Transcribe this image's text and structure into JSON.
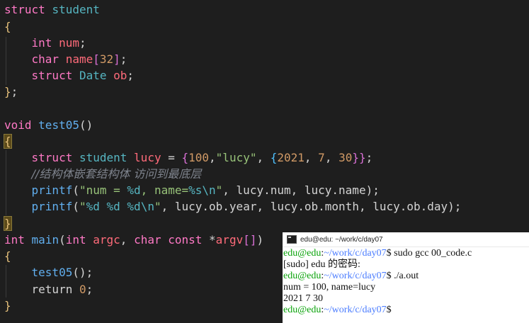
{
  "code": {
    "l1": {
      "k": "struct",
      "n": "student"
    },
    "l2": {
      "b": "{"
    },
    "l3": {
      "t": "int",
      "v": "num",
      "p": ";"
    },
    "l4": {
      "t": "char",
      "v": "name",
      "b1": "[",
      "n": "32",
      "b2": "]",
      "p": ";"
    },
    "l5": {
      "k": "struct",
      "t": "Date",
      "v": "ob",
      "p": ";"
    },
    "l6": {
      "b": "}",
      "p": ";"
    },
    "l8": {
      "t": "void",
      "f": "test05",
      "p": "()"
    },
    "l9": {
      "b": "{"
    },
    "l10": {
      "k": "struct",
      "t": "student",
      "v": "lucy",
      "eq": " = ",
      "b1": "{",
      "n1": "100",
      "c1": ",",
      "s1": "\"lucy\"",
      "c2": ", ",
      "b2": "{",
      "n2": "2021",
      "c3": ", ",
      "n3": "7",
      "c4": ", ",
      "n4": "30",
      "b3": "}}",
      "p": ";"
    },
    "l11": {
      "comment": "//结构体嵌套结构体 访问到最底层"
    },
    "l12": {
      "f": "printf",
      "o": "(",
      "s1": "\"num = ",
      "e1": "%d",
      "s2": ", name=",
      "e2": "%s",
      "e3": "\\n",
      "s3": "\"",
      "rest": ", lucy.num, lucy.name);"
    },
    "l13": {
      "f": "printf",
      "o": "(",
      "s1": "\"",
      "e1": "%d",
      "e2": "%d",
      "e3": "%d",
      "e4": "\\n",
      "s2": "\"",
      "rest": ", lucy.ob.year, lucy.ob.month, lucy.ob.day);"
    },
    "l14": {
      "b": "}"
    },
    "l15": {
      "t": "int",
      "f": "main",
      "o": "(",
      "t2": "int",
      "v1": "argc",
      "c": ", ",
      "t3": "char",
      "k": "const",
      "star": " *",
      "v2": "argv",
      "b": "[]",
      "p": ")"
    },
    "l16": {
      "b": "{"
    },
    "l17": {
      "f": "test05",
      "p": "();"
    },
    "l18": {
      "k": "return",
      "n": "0",
      "p": ";"
    },
    "l19": {
      "b": "}"
    }
  },
  "terminal": {
    "title": "edu@edu: ~/work/c/day07",
    "lines": [
      {
        "user": "edu@edu",
        "sep": ":",
        "path": "~/work/c/day07",
        "cmd": "$ sudo gcc 00_code.c"
      },
      {
        "text": "[sudo] edu 的密码:"
      },
      {
        "user": "edu@edu",
        "sep": ":",
        "path": "~/work/c/day07",
        "cmd": "$ ./a.out"
      },
      {
        "text": "num = 100, name=lucy"
      },
      {
        "text": "2021 7 30"
      },
      {
        "user": "edu@edu",
        "sep": ":",
        "path": "~/work/c/day07",
        "cmd": "$"
      }
    ]
  }
}
